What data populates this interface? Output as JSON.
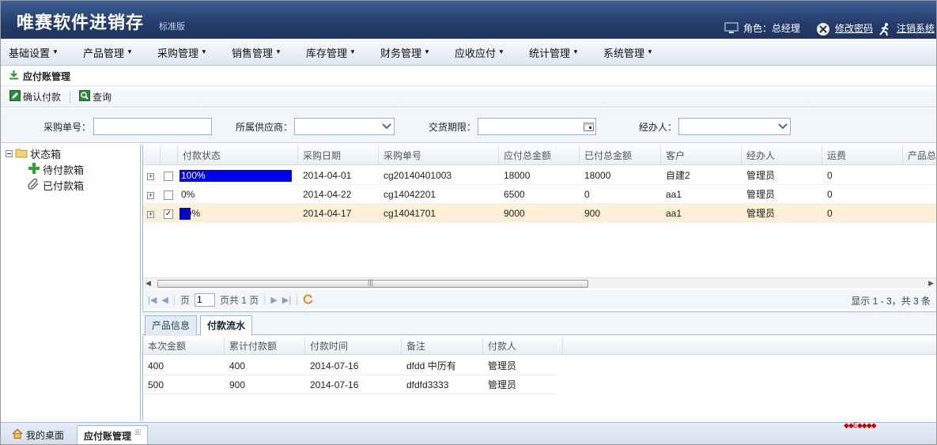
{
  "header": {
    "brand": "唯赛软件进销存",
    "edition": "标准版",
    "role_label": "角色：总经理",
    "change_password": "修改密码",
    "logout": "注销系统"
  },
  "menu": [
    "基础设置",
    "产品管理",
    "采购管理",
    "销售管理",
    "库存管理",
    "财务管理",
    "应收应付",
    "统计管理",
    "系统管理"
  ],
  "page_title": "应付账管理",
  "toolbar": {
    "confirm_pay": "确认付款",
    "query": "查询"
  },
  "search": {
    "order_no_label": "采购单号：",
    "supplier_label": "所属供应商：",
    "due_label": "交货期限：",
    "handler_label": "经办人："
  },
  "tree": {
    "root": "状态箱",
    "pending": "待付款箱",
    "paid": "已付款箱"
  },
  "grid": {
    "columns": [
      "付款状态",
      "采购日期",
      "采购单号",
      "应付总金额",
      "已付总金额",
      "客户",
      "经办人",
      "运费",
      "产品总"
    ],
    "rows": [
      {
        "status": "100%",
        "progress": 1.0,
        "date": "2014-04-01",
        "no": "cg20140401003",
        "total": "18000",
        "paid": "18000",
        "customer": "自建2",
        "handler": "管理员",
        "freight": "0",
        "checked": false,
        "selected": false
      },
      {
        "status": "0%",
        "progress": 0.0,
        "date": "2014-04-22",
        "no": "cg14042201",
        "total": "6500",
        "paid": "0",
        "customer": "aa1",
        "handler": "管理员",
        "freight": "0",
        "checked": false,
        "selected": false
      },
      {
        "status": "10%",
        "progress": 0.1,
        "date": "2014-04-17",
        "no": "cg14041701",
        "total": "9000",
        "paid": "900",
        "customer": "aa1",
        "handler": "管理员",
        "freight": "0",
        "checked": true,
        "selected": true
      }
    ]
  },
  "pager": {
    "page_prefix": "页",
    "page_value": "1",
    "page_suffix": "页共 1 页",
    "info": "显示 1 - 3，共 3 条"
  },
  "sub_tabs": [
    "产品信息",
    "付款流水"
  ],
  "sub_grid": {
    "columns": [
      "本次金额",
      "累计付款额",
      "付款时间",
      "备注",
      "付款人"
    ],
    "rows": [
      [
        "400",
        "400",
        "2014-07-16",
        "dfdd 中历有",
        "管理员"
      ],
      [
        "500",
        "900",
        "2014-07-16",
        "dfdfd3333",
        "管理员"
      ]
    ]
  },
  "bottom_tabs": [
    "我的桌面",
    "应付账管理"
  ],
  "footer_mark": "◆◆E◆◆◆◆"
}
